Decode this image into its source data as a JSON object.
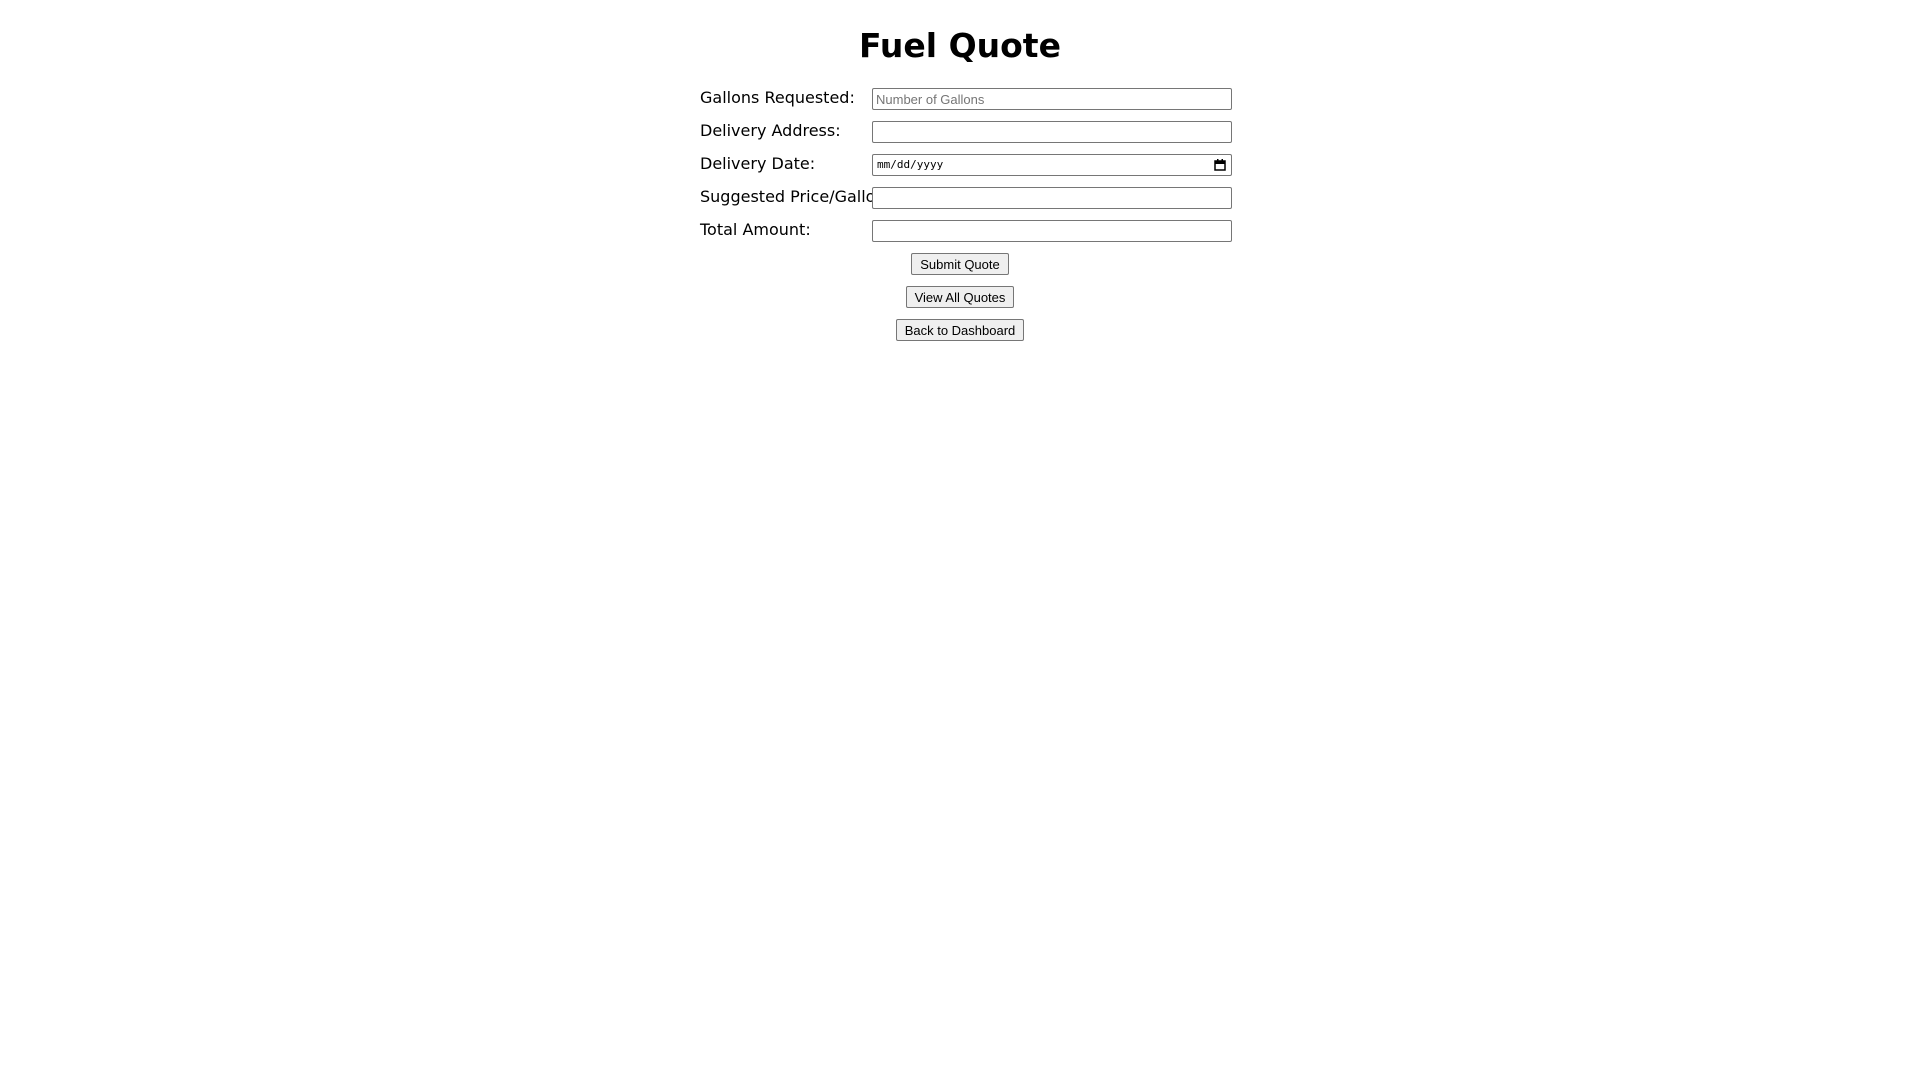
{
  "page": {
    "title": "Fuel Quote"
  },
  "form": {
    "gallons": {
      "label": "Gallons Requested:",
      "placeholder": "Number of Gallons",
      "value": ""
    },
    "address": {
      "label": "Delivery Address:",
      "value": ""
    },
    "date": {
      "label": "Delivery Date:",
      "display": "mm/dd/yyyy",
      "icon": "calendar-icon"
    },
    "price": {
      "label": "Suggested Price/Gallon:",
      "value": ""
    },
    "total": {
      "label": "Total Amount:",
      "value": ""
    }
  },
  "buttons": {
    "submit": "Submit Quote",
    "view_all": "View All Quotes",
    "back": "Back to Dashboard"
  }
}
